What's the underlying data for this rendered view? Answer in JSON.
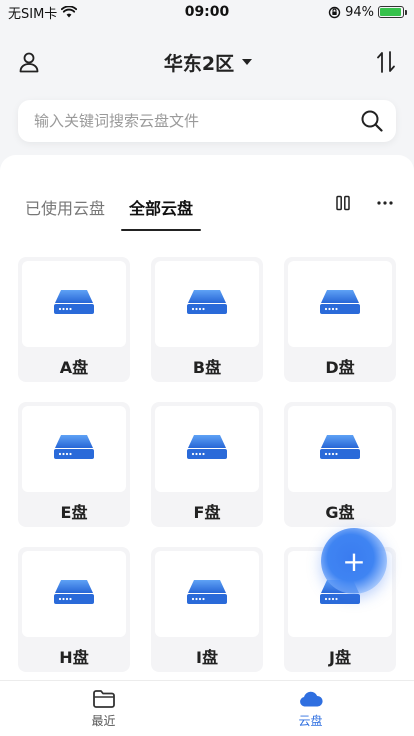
{
  "status_bar": {
    "carrier": "无SIM卡",
    "time": "09:00",
    "battery": "94%",
    "battery_level": 0.94
  },
  "header": {
    "region": "华东2区"
  },
  "search": {
    "placeholder": "输入关键词搜索云盘文件"
  },
  "tabs": [
    {
      "label": "已使用云盘",
      "active": false
    },
    {
      "label": "全部云盘",
      "active": true
    }
  ],
  "disks": [
    {
      "label": "A盘"
    },
    {
      "label": "B盘"
    },
    {
      "label": "D盘"
    },
    {
      "label": "E盘"
    },
    {
      "label": "F盘"
    },
    {
      "label": "G盘"
    },
    {
      "label": "H盘"
    },
    {
      "label": "I盘"
    },
    {
      "label": "J盘"
    }
  ],
  "fab": {
    "symbol": "+"
  },
  "bottom_nav": [
    {
      "label": "最近",
      "icon": "folder-icon",
      "active": false
    },
    {
      "label": "云盘",
      "icon": "cloud-icon",
      "active": true
    }
  ],
  "colors": {
    "accent": "#2f6fe0",
    "battery": "#36c24c"
  }
}
